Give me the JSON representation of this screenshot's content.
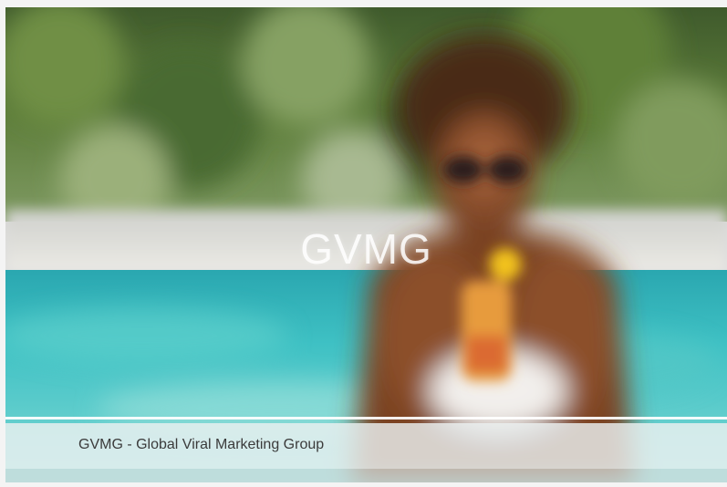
{
  "slide": {
    "image_alt": "Woman in sunglasses holding a drink in a swimming pool",
    "overlay_title": "GVMG",
    "caption": "GVMG - Global Viral Marketing Group"
  }
}
